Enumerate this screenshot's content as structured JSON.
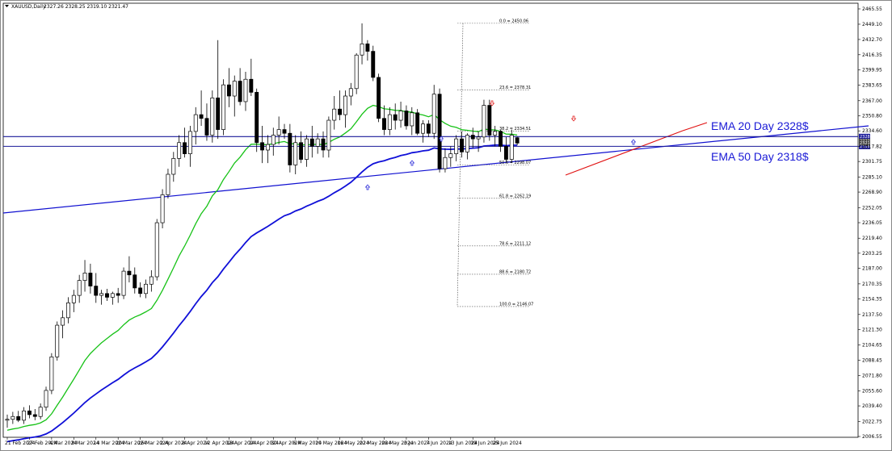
{
  "header": {
    "symbol": "XAUUSD,Daily",
    "ohlc": "2327.26 2328.25 2319.10 2321.47"
  },
  "chart_data": {
    "type": "candlestick",
    "title": "XAUUSD,Daily",
    "y_ticks": [
      2465.55,
      2449.1,
      2432.7,
      2416.35,
      2399.95,
      2383.65,
      2367.0,
      2350.8,
      2334.6,
      2317.82,
      2301.75,
      2285.1,
      2268.9,
      2252.05,
      2236.05,
      2219.4,
      2203.25,
      2187.0,
      2170.35,
      2154.35,
      2137.5,
      2121.3,
      2104.65,
      2088.45,
      2071.8,
      2055.6,
      2039.4,
      2022.75,
      2006.55
    ],
    "ylim": [
      2006.55,
      2465.55
    ],
    "x_tick_labels": [
      "21 Feb 2024",
      "27 Feb 2024",
      "4 Mar 2024",
      "8 Mar 2024",
      "14 Mar 2024",
      "20 Mar 2024",
      "26 Mar 2024",
      "2 Apr 2024",
      "8 Apr 2024",
      "12 Apr 2024",
      "18 Apr 2024",
      "24 Apr 2024",
      "30 Apr 2024",
      "6 May 2024",
      "10 May 2024",
      "16 May 2024",
      "22 May 2024",
      "28 May 2024",
      "3 Jun 2024",
      "7 Jun 2024",
      "13 Jun 2024",
      "19 Jun 2024",
      "25 Jun 2024"
    ],
    "candles": [
      [
        2024,
        2030,
        2016,
        2025
      ],
      [
        2025,
        2033,
        2020,
        2028
      ],
      [
        2028,
        2034,
        2022,
        2024
      ],
      [
        2024,
        2038,
        2020,
        2034
      ],
      [
        2034,
        2040,
        2026,
        2030
      ],
      [
        2030,
        2036,
        2024,
        2028
      ],
      [
        2028,
        2042,
        2025,
        2038
      ],
      [
        2038,
        2060,
        2034,
        2056
      ],
      [
        2056,
        2096,
        2052,
        2092
      ],
      [
        2092,
        2130,
        2088,
        2126
      ],
      [
        2126,
        2142,
        2112,
        2134
      ],
      [
        2134,
        2156,
        2128,
        2150
      ],
      [
        2150,
        2164,
        2140,
        2158
      ],
      [
        2158,
        2180,
        2150,
        2174
      ],
      [
        2174,
        2196,
        2162,
        2182
      ],
      [
        2182,
        2192,
        2160,
        2168
      ],
      [
        2168,
        2182,
        2150,
        2158
      ],
      [
        2158,
        2164,
        2148,
        2160
      ],
      [
        2160,
        2165,
        2152,
        2156
      ],
      [
        2156,
        2162,
        2148,
        2160
      ],
      [
        2160,
        2166,
        2150,
        2158
      ],
      [
        2158,
        2188,
        2154,
        2184
      ],
      [
        2184,
        2200,
        2172,
        2180
      ],
      [
        2180,
        2188,
        2160,
        2166
      ],
      [
        2166,
        2172,
        2156,
        2160
      ],
      [
        2160,
        2175,
        2155,
        2170
      ],
      [
        2170,
        2185,
        2162,
        2178
      ],
      [
        2178,
        2240,
        2174,
        2236
      ],
      [
        2236,
        2272,
        2230,
        2266
      ],
      [
        2266,
        2294,
        2262,
        2288
      ],
      [
        2288,
        2312,
        2280,
        2305
      ],
      [
        2305,
        2330,
        2296,
        2322
      ],
      [
        2322,
        2338,
        2306,
        2310
      ],
      [
        2310,
        2340,
        2296,
        2334
      ],
      [
        2334,
        2360,
        2320,
        2352
      ],
      [
        2352,
        2378,
        2340,
        2348
      ],
      [
        2348,
        2364,
        2324,
        2330
      ],
      [
        2330,
        2378,
        2322,
        2370
      ],
      [
        2370,
        2432,
        2326,
        2336
      ],
      [
        2336,
        2390,
        2330,
        2384
      ],
      [
        2384,
        2402,
        2360,
        2372
      ],
      [
        2372,
        2394,
        2350,
        2388
      ],
      [
        2388,
        2402,
        2362,
        2366
      ],
      [
        2366,
        2398,
        2356,
        2390
      ],
      [
        2390,
        2412,
        2372,
        2376
      ],
      [
        2376,
        2380,
        2312,
        2322
      ],
      [
        2322,
        2340,
        2300,
        2314
      ],
      [
        2314,
        2330,
        2300,
        2320
      ],
      [
        2320,
        2338,
        2308,
        2330
      ],
      [
        2330,
        2350,
        2320,
        2336
      ],
      [
        2336,
        2342,
        2326,
        2332
      ],
      [
        2332,
        2342,
        2290,
        2298
      ],
      [
        2298,
        2330,
        2288,
        2322
      ],
      [
        2322,
        2334,
        2300,
        2304
      ],
      [
        2304,
        2330,
        2296,
        2326
      ],
      [
        2326,
        2340,
        2306,
        2318
      ],
      [
        2318,
        2332,
        2310,
        2326
      ],
      [
        2326,
        2334,
        2306,
        2314
      ],
      [
        2314,
        2350,
        2306,
        2346
      ],
      [
        2346,
        2372,
        2336,
        2358
      ],
      [
        2358,
        2378,
        2346,
        2352
      ],
      [
        2352,
        2378,
        2338,
        2372
      ],
      [
        2372,
        2386,
        2362,
        2380
      ],
      [
        2380,
        2418,
        2374,
        2416
      ],
      [
        2416,
        2450,
        2406,
        2428
      ],
      [
        2428,
        2432,
        2410,
        2420
      ],
      [
        2420,
        2426,
        2388,
        2392
      ],
      [
        2392,
        2396,
        2344,
        2348
      ],
      [
        2348,
        2362,
        2330,
        2336
      ],
      [
        2336,
        2360,
        2330,
        2352
      ],
      [
        2352,
        2364,
        2336,
        2346
      ],
      [
        2346,
        2366,
        2338,
        2356
      ],
      [
        2356,
        2362,
        2336,
        2340
      ],
      [
        2340,
        2360,
        2330,
        2354
      ],
      [
        2354,
        2358,
        2330,
        2332
      ],
      [
        2332,
        2346,
        2322,
        2342
      ],
      [
        2342,
        2346,
        2328,
        2332
      ],
      [
        2332,
        2384,
        2326,
        2374
      ],
      [
        2374,
        2380,
        2290,
        2294
      ],
      [
        2294,
        2316,
        2290,
        2306
      ],
      [
        2306,
        2318,
        2296,
        2310
      ],
      [
        2310,
        2330,
        2302,
        2326
      ],
      [
        2326,
        2334,
        2306,
        2312
      ],
      [
        2312,
        2332,
        2304,
        2330
      ],
      [
        2330,
        2338,
        2316,
        2326
      ],
      [
        2326,
        2334,
        2312,
        2328
      ],
      [
        2328,
        2368,
        2322,
        2362
      ],
      [
        2362,
        2368,
        2324,
        2330
      ],
      [
        2330,
        2340,
        2318,
        2334
      ],
      [
        2334,
        2336,
        2312,
        2318
      ],
      [
        2318,
        2328,
        2300,
        2304
      ],
      [
        2304,
        2336,
        2300,
        2330
      ],
      [
        2327.26,
        2328.25,
        2319.1,
        2321.47
      ]
    ],
    "series": [
      {
        "name": "EMA 20 Day",
        "values_from": "computed",
        "color": "#17c217",
        "last": 2328
      },
      {
        "name": "EMA 50 Day",
        "values_from": "computed",
        "color": "#1010d8",
        "last": 2318
      }
    ],
    "fibonacci": {
      "high": 2450.06,
      "low": 2146.07,
      "levels": [
        {
          "label": "0.0 = 2450.06",
          "price": 2450.06
        },
        {
          "label": "23.6 = 2378.31",
          "price": 2378.31
        },
        {
          "label": "38.2 = 2334.51",
          "price": 2334.51
        },
        {
          "label": "50.0 = 2298.07",
          "price": 2298.07
        },
        {
          "label": "61.8 = 2262.19",
          "price": 2262.19
        },
        {
          "label": "78.6 = 2211.12",
          "price": 2211.12
        },
        {
          "label": "88.6 = 2180.72",
          "price": 2180.72
        },
        {
          "label": "100.0 = 2146.07",
          "price": 2146.07
        }
      ]
    },
    "horizontal_lines": [
      {
        "price": 2328.44,
        "tag": "2328.44",
        "color": "#1a1a9a"
      },
      {
        "price": 2318.0,
        "tag": "2318.00",
        "color": "#1a1a9a"
      }
    ],
    "price_tags": [
      {
        "label": "2323.61",
        "price": 2323.6
      },
      {
        "label": "2321.47",
        "price": 2321.5
      }
    ],
    "annotations": [
      {
        "text": "EMA 20 Day  2328$",
        "anchor": "upper-right"
      },
      {
        "text": "EMA 50 Day  2318$",
        "anchor": "lower-right"
      }
    ],
    "grid": false,
    "legend": "none"
  }
}
